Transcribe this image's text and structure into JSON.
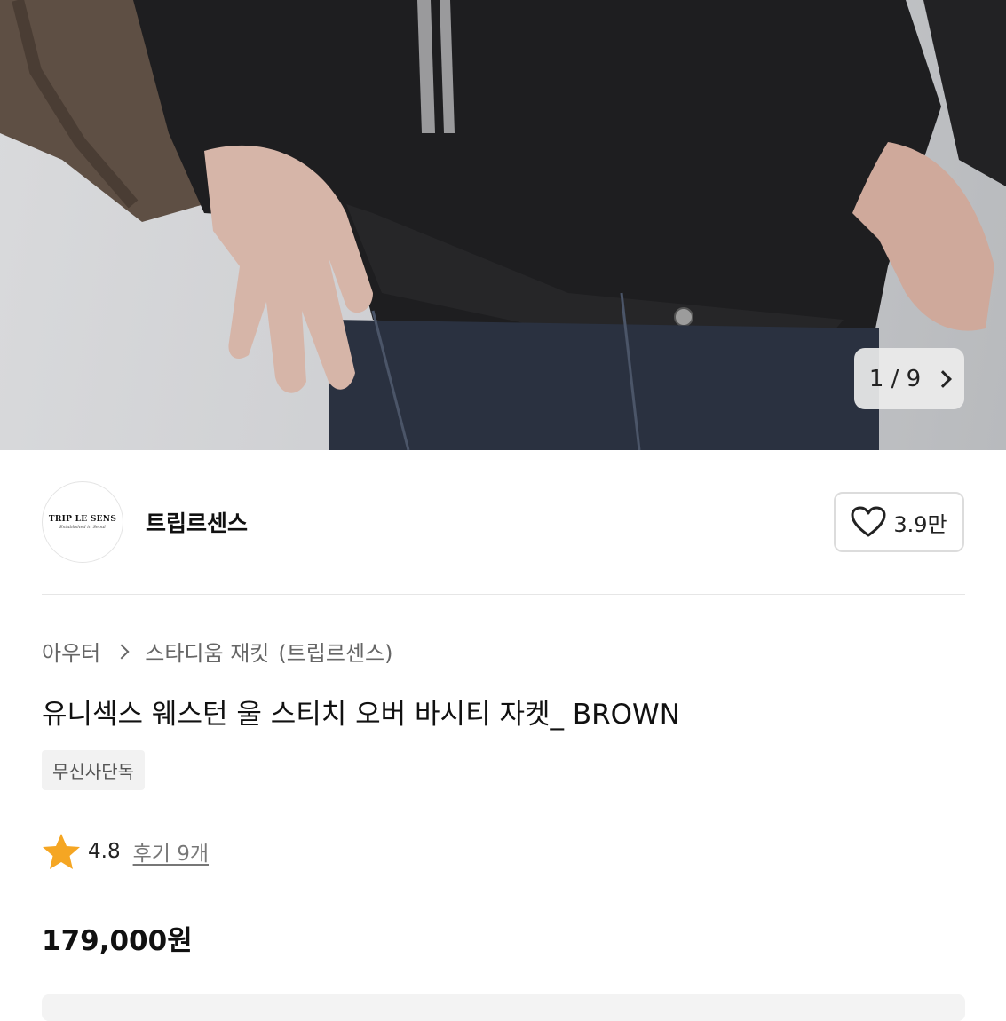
{
  "product_image": {
    "counter_current": "1",
    "counter_total": "9",
    "counter_text": "1 / 9",
    "icon": "chevron-right-icon"
  },
  "brand": {
    "logo_text": "TRIP LE SENS",
    "logo_subtext": "Established in Seoul",
    "name": "트립르센스",
    "like_icon": "heart-outline-icon",
    "like_count": "3.9만"
  },
  "breadcrumb": {
    "category": "아우터",
    "subcategory": "스타디움 재킷",
    "brand_paren": "(트립르센스)"
  },
  "product": {
    "title": "유니섹스 웨스턴 울 스티치 오버 바시티 자켓_ BROWN",
    "badge": "무신사단독",
    "rating_icon": "star-icon",
    "rating": "4.8",
    "reviews_label": "후기 9개",
    "price": "179,000원"
  },
  "colors": {
    "star": "#f5a623",
    "text_primary": "#111111",
    "text_secondary": "#666666",
    "badge_bg": "#f2f2f2"
  }
}
